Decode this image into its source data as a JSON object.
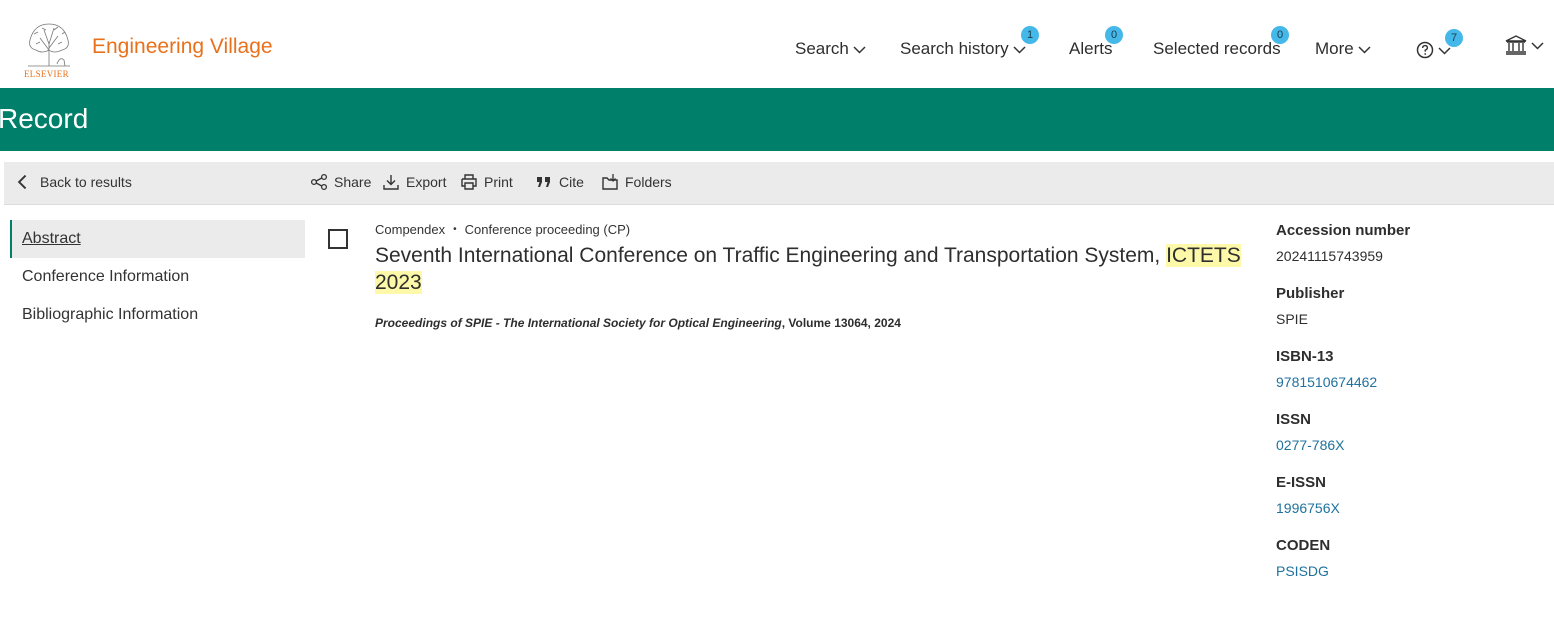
{
  "header": {
    "brand": "Engineering Village",
    "logo_text": "ELSEVIER",
    "nav": [
      {
        "label": "Search",
        "icon": "chevron-down-icon"
      },
      {
        "label": "Search history",
        "badge": "1",
        "icon": "chevron-down-icon"
      },
      {
        "label": "Alerts",
        "badge": "0"
      },
      {
        "label": "Selected records",
        "badge": "0"
      },
      {
        "label": "More",
        "icon": "chevron-down-icon"
      }
    ],
    "help_badge": "7",
    "accent": "#e9711c",
    "badge_color": "#44b8e8"
  },
  "banner": {
    "title": "Record",
    "color": "#007f6a"
  },
  "toolbar": {
    "back_label": "Back to results",
    "share_label": "Share",
    "export_label": "Export",
    "print_label": "Print",
    "cite_label": "Cite",
    "folders_label": "Folders"
  },
  "leftnav": {
    "items": [
      "Abstract",
      "Conference Information",
      "Bibliographic Information"
    ]
  },
  "record": {
    "database": "Compendex",
    "doc_type": "Conference proceeding (CP)",
    "title_part1": "Seventh International Conference on Traffic Engineering and Transportation System, ",
    "title_highlight1": "ICTETS",
    "title_highlight2": "2023",
    "source_journal": "Proceedings of SPIE - The International Society for Optical Engineering",
    "source_rest": ", Volume 13064, 2024"
  },
  "details": {
    "accession_label": "Accession number",
    "accession_value": "20241115743959",
    "publisher_label": "Publisher",
    "publisher_value": "SPIE",
    "isbn_label": "ISBN-13",
    "isbn_value": "9781510674462",
    "issn_label": "ISSN",
    "issn_value": "0277-786X",
    "eissn_label": "E-ISSN",
    "eissn_value": "1996756X",
    "coden_label": "CODEN",
    "coden_value": "PSISDG",
    "link_color": "#20729e"
  }
}
